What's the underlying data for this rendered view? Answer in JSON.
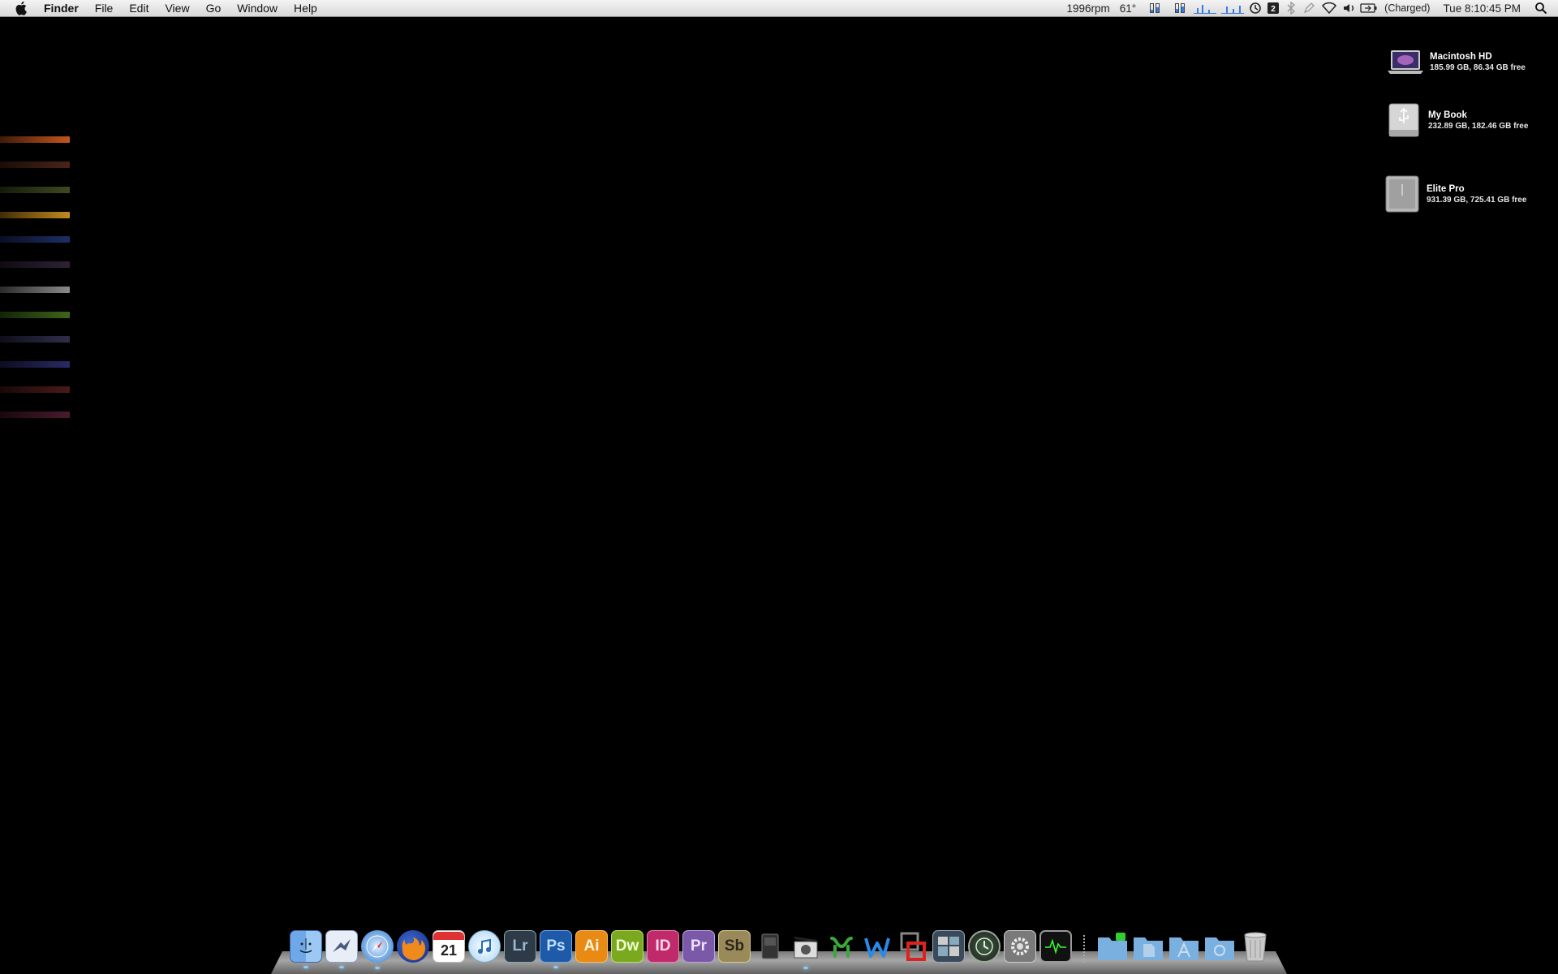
{
  "menubar": {
    "app_name": "Finder",
    "menus": [
      "File",
      "Edit",
      "View",
      "Go",
      "Window",
      "Help"
    ],
    "fan_speed": "1996rpm",
    "temperature": "61°",
    "battery_status": "(Charged)",
    "clock": "Tue 8:10:45 PM"
  },
  "drives": [
    {
      "name": "Macintosh HD",
      "info": "185.99 GB, 86.34 GB free"
    },
    {
      "name": "My Book",
      "info": "232.89 GB, 182.46 GB free"
    },
    {
      "name": "Elite Pro",
      "info": "931.39 GB, 725.41 GB free"
    }
  ],
  "colors": {
    "glow_bars": [
      "#c2561e",
      "#4a2418",
      "#3e4a22",
      "#c28a1e",
      "#1e2e66",
      "#2e2236",
      "#8a8a8a",
      "#3e6618",
      "#2e2e4a",
      "#2a2a66",
      "#4a1a1a",
      "#4a1a2e"
    ]
  },
  "dock": {
    "apps": [
      {
        "name": "finder",
        "label": ""
      },
      {
        "name": "mail",
        "label": ""
      },
      {
        "name": "safari",
        "label": ""
      },
      {
        "name": "firefox",
        "label": ""
      },
      {
        "name": "ical",
        "label": "21"
      },
      {
        "name": "itunes",
        "label": ""
      },
      {
        "name": "lightroom",
        "label": "Lr"
      },
      {
        "name": "photoshop",
        "label": "Ps"
      },
      {
        "name": "illustrator",
        "label": "Ai"
      },
      {
        "name": "dreamweaver",
        "label": "Dw"
      },
      {
        "name": "indesign",
        "label": "ID"
      },
      {
        "name": "premiere",
        "label": "Pr"
      },
      {
        "name": "soundbooth",
        "label": "Sb"
      },
      {
        "name": "dvd-player",
        "label": ""
      },
      {
        "name": "final-cut",
        "label": ""
      },
      {
        "name": "app-green",
        "label": ""
      },
      {
        "name": "app-blue-w",
        "label": ""
      },
      {
        "name": "parallels",
        "label": ""
      },
      {
        "name": "dashboard",
        "label": ""
      },
      {
        "name": "time-machine",
        "label": ""
      },
      {
        "name": "system-preferences",
        "label": ""
      },
      {
        "name": "activity-monitor",
        "label": ""
      }
    ],
    "stacks": [
      "applications-folder",
      "documents-folder",
      "apps-stack-folder",
      "downloads-folder",
      "trash"
    ]
  }
}
